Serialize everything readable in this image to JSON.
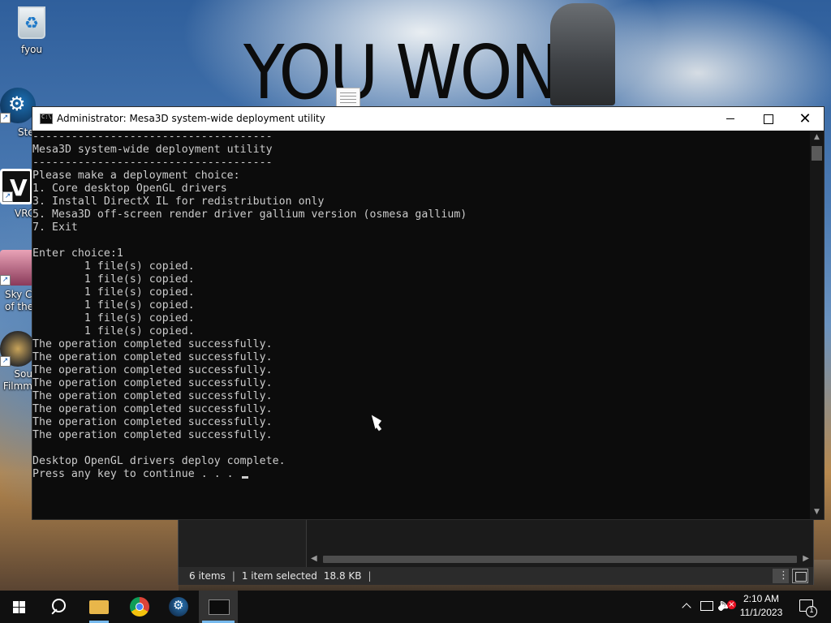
{
  "wallpaper": {
    "headline": "YOU WON"
  },
  "desktop_icons": [
    {
      "label": "fyou",
      "icon": "recycle-bin-icon"
    },
    {
      "label": "Ste",
      "icon": "steam-icon"
    },
    {
      "label": "VRC",
      "icon": "vrchat-icon"
    },
    {
      "label": "Sky Ch\nof the",
      "icon": "sky-icon"
    },
    {
      "label": "Sou\nFilmm",
      "icon": "source-filmmaker-icon"
    }
  ],
  "console": {
    "title": "Administrator:  Mesa3D system-wide deployment utility",
    "lines": [
      "-------------------------------------",
      "Mesa3D system-wide deployment utility",
      "-------------------------------------",
      "Please make a deployment choice:",
      "1. Core desktop OpenGL drivers",
      "3. Install DirectX IL for redistribution only",
      "5. Mesa3D off-screen render driver gallium version (osmesa gallium)",
      "7. Exit",
      "",
      "Enter choice:1",
      "        1 file(s) copied.",
      "        1 file(s) copied.",
      "        1 file(s) copied.",
      "        1 file(s) copied.",
      "        1 file(s) copied.",
      "        1 file(s) copied.",
      "The operation completed successfully.",
      "The operation completed successfully.",
      "The operation completed successfully.",
      "The operation completed successfully.",
      "The operation completed successfully.",
      "The operation completed successfully.",
      "The operation completed successfully.",
      "The operation completed successfully.",
      "",
      "Desktop OpenGL drivers deploy complete.",
      "Press any key to continue . . . "
    ]
  },
  "explorer": {
    "status_items": "6 items",
    "status_selected": "1 item selected",
    "status_size": "18.8 KB"
  },
  "taskbar": {
    "time": "2:10 AM",
    "date": "11/1/2023",
    "notification_count": "1",
    "pinned": [
      "start-icon",
      "search-icon",
      "file-explorer-icon",
      "chrome-icon",
      "steam-icon",
      "command-prompt-icon"
    ]
  }
}
